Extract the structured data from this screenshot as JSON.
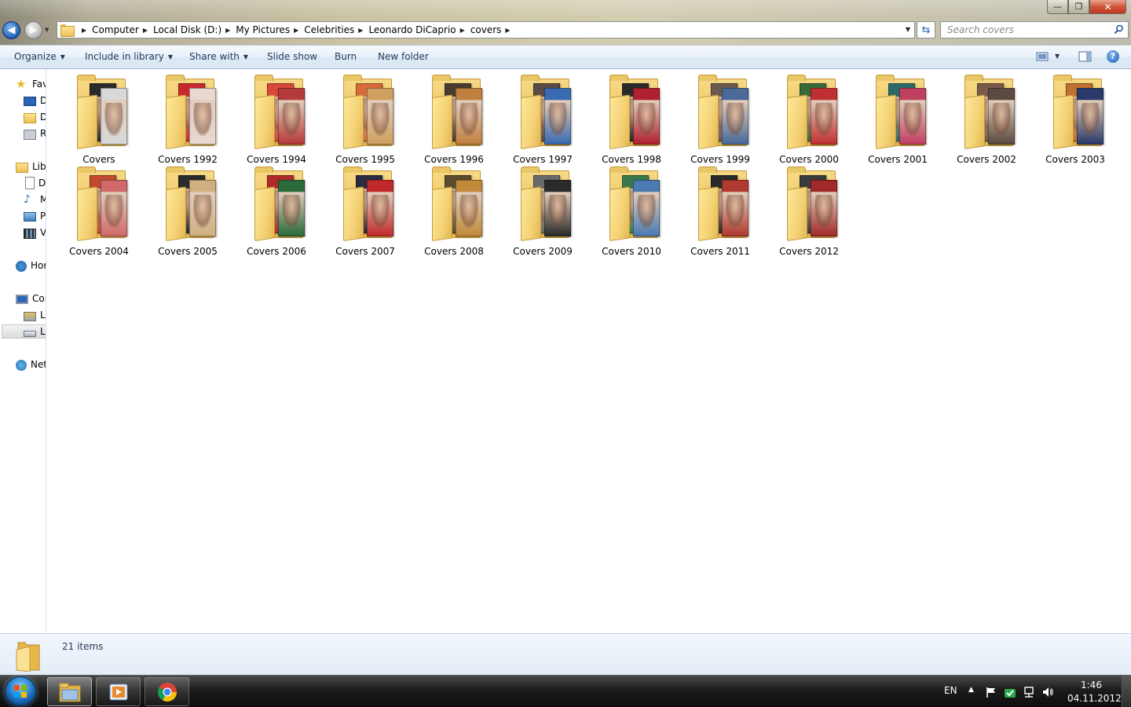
{
  "window": {
    "controls": {
      "minimize": "—",
      "maximize": "❐",
      "close": "✕"
    }
  },
  "address": {
    "breadcrumbs": [
      "Computer",
      "Local Disk (D:)",
      "My Pictures",
      "Celebrities",
      "Leonardo DiCaprio",
      "covers"
    ]
  },
  "search": {
    "placeholder": "Search covers"
  },
  "toolbar": {
    "organize": "Organize",
    "include_in_library": "Include in library",
    "share_with": "Share with",
    "slide_show": "Slide show",
    "burn": "Burn",
    "new_folder": "New folder",
    "help": "?"
  },
  "nav": {
    "favorites": "Favorites",
    "desktop": "Desktop",
    "downloads": "Downloads",
    "recent_places": "Recent Places",
    "libraries": "Libraries",
    "documents": "Documents",
    "music": "Music",
    "pictures": "Pictures",
    "videos": "Videos",
    "homegroup": "Homegroup",
    "computer": "Computer",
    "local_disk_c": "Local Disk (C:)",
    "local_disk_d": "Local Disk (D:)",
    "network": "Network"
  },
  "folders": [
    {
      "label": "Covers",
      "colors": [
        "#2a2a2a",
        "#d8d8d8"
      ]
    },
    {
      "label": "Covers 1992",
      "colors": [
        "#c9282e",
        "#e8d8cf"
      ]
    },
    {
      "label": "Covers 1994",
      "colors": [
        "#d9483a",
        "#b53a3a"
      ]
    },
    {
      "label": "Covers 1995",
      "colors": [
        "#d96a3a",
        "#cfa060"
      ]
    },
    {
      "label": "Covers 1996",
      "colors": [
        "#4a3a30",
        "#c08040"
      ]
    },
    {
      "label": "Covers 1997",
      "colors": [
        "#5a4a48",
        "#3a6ab0"
      ]
    },
    {
      "label": "Covers 1998",
      "colors": [
        "#2a2a2a",
        "#b02030"
      ]
    },
    {
      "label": "Covers 1999",
      "colors": [
        "#6a5a50",
        "#4a6a9a"
      ]
    },
    {
      "label": "Covers 2000",
      "colors": [
        "#3a6a3a",
        "#c03030"
      ]
    },
    {
      "label": "Covers 2001",
      "colors": [
        "#2a6a6a",
        "#c04060"
      ]
    },
    {
      "label": "Covers 2002",
      "colors": [
        "#7a5a48",
        "#5a4a40"
      ]
    },
    {
      "label": "Covers 2003",
      "colors": [
        "#c07030",
        "#2a3a6a"
      ]
    },
    {
      "label": "Covers 2004",
      "colors": [
        "#c04a30",
        "#d06a6a"
      ]
    },
    {
      "label": "Covers 2005",
      "colors": [
        "#2a2a2a",
        "#d0b080"
      ]
    },
    {
      "label": "Covers 2006",
      "colors": [
        "#b02a2a",
        "#2a6a3a"
      ]
    },
    {
      "label": "Covers 2007",
      "colors": [
        "#2a2a40",
        "#c02a2a"
      ]
    },
    {
      "label": "Covers 2008",
      "colors": [
        "#5a4a30",
        "#c08a3a"
      ]
    },
    {
      "label": "Covers 2009",
      "colors": [
        "#6a6a6a",
        "#2a2a2a"
      ]
    },
    {
      "label": "Covers 2010",
      "colors": [
        "#3a7a4a",
        "#4a7ab0"
      ]
    },
    {
      "label": "Covers 2011",
      "colors": [
        "#2a2a2a",
        "#b03a30"
      ]
    },
    {
      "label": "Covers 2012",
      "colors": [
        "#3a3a3a",
        "#a02a2a"
      ]
    }
  ],
  "details": {
    "count": "21 items"
  },
  "taskbar": {
    "language": "EN",
    "time": "1:46",
    "date": "04.11.2012"
  }
}
